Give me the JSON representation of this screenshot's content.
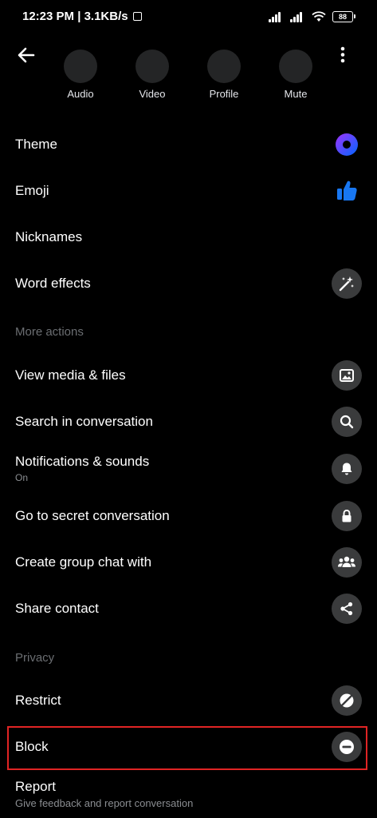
{
  "status_bar": {
    "time": "12:23 PM",
    "network_speed": "| 3.1KB/s",
    "battery": "88"
  },
  "quick_actions": [
    {
      "label": "Audio"
    },
    {
      "label": "Video"
    },
    {
      "label": "Profile"
    },
    {
      "label": "Mute"
    }
  ],
  "menu": {
    "theme": "Theme",
    "emoji": "Emoji",
    "nicknames": "Nicknames",
    "word_effects": "Word effects",
    "more_actions_header": "More actions",
    "view_media": "View media & files",
    "search": "Search in conversation",
    "notifications": "Notifications  & sounds",
    "notifications_sub": "On",
    "secret": "Go to secret conversation",
    "group_chat": "Create group chat with",
    "share_contact": "Share contact",
    "privacy_header": "Privacy",
    "restrict": "Restrict",
    "block": "Block",
    "report": "Report",
    "report_sub": "Give feedback and report conversation"
  },
  "colors": {
    "background": "#000000",
    "icon_circle": "#3a3b3c",
    "emoji_like": "#1877f2",
    "theme_gradient_start": "#a033ff",
    "theme_gradient_end": "#0066ff",
    "highlight": "#e02424",
    "section_header": "#6b6e72"
  },
  "icons": {
    "back": "arrow-left-icon",
    "more": "vertical-dots-icon",
    "theme": "theme-circle-icon",
    "emoji": "thumbs-up-icon",
    "word_effects": "magic-wand-icon",
    "view_media": "image-icon",
    "search": "search-icon",
    "notifications": "bell-icon",
    "secret": "lock-icon",
    "group_chat": "group-icon",
    "share_contact": "share-icon",
    "restrict": "restrict-icon",
    "block": "block-icon"
  }
}
